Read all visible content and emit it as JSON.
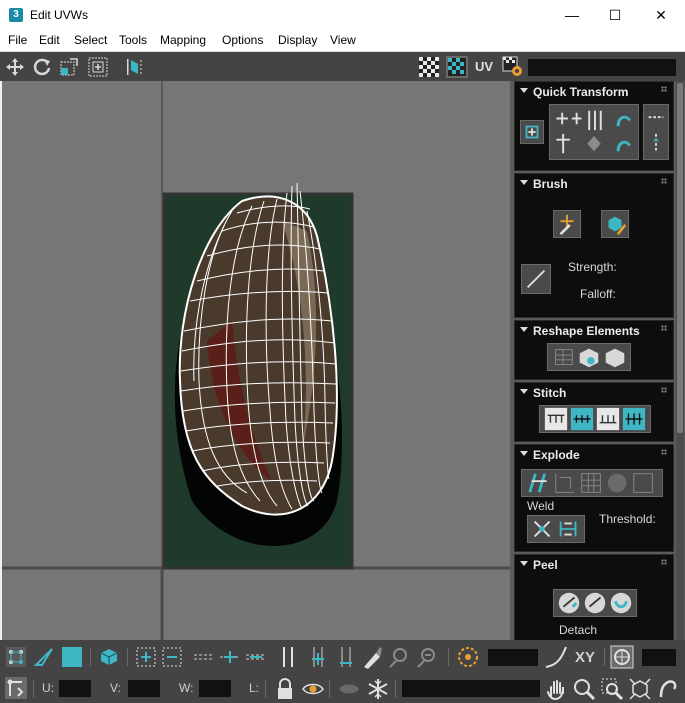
{
  "window": {
    "title": "Edit UVWs",
    "app_icon": "3",
    "minimize": "—",
    "maximize": "☐",
    "close": "✕"
  },
  "menu": [
    "File",
    "Edit",
    "Select",
    "Tools",
    "Mapping",
    "Options",
    "Display",
    "View"
  ],
  "toolbar_top": {
    "uv_label": "UV",
    "icons": [
      "move-icon",
      "rotate-icon",
      "scale-icon",
      "freeform-icon",
      "mirror-icon",
      "checker-icon",
      "checker-map-icon",
      "uv-label",
      "settings-icon"
    ]
  },
  "panel": {
    "quick_transform": {
      "title": "Quick Transform"
    },
    "brush": {
      "title": "Brush",
      "strength_label": "Strength:",
      "falloff_label": "Falloff:"
    },
    "reshape": {
      "title": "Reshape Elements"
    },
    "stitch": {
      "title": "Stitch"
    },
    "explode": {
      "title": "Explode",
      "weld_label": "Weld",
      "threshold_label": "Threshold:"
    },
    "peel": {
      "title": "Peel",
      "detach_label": "Detach"
    }
  },
  "bottom": {
    "xy_label": "XY",
    "u_label": "U:",
    "v_label": "V:",
    "w_label": "W:",
    "l_label": "L:"
  },
  "colors": {
    "accent": "#3fb6c4",
    "panel_bg": "#0d0d0d",
    "toolbar_bg": "#444444",
    "viewport_bg": "#767676",
    "texture_bg": "#1f3a2a"
  }
}
